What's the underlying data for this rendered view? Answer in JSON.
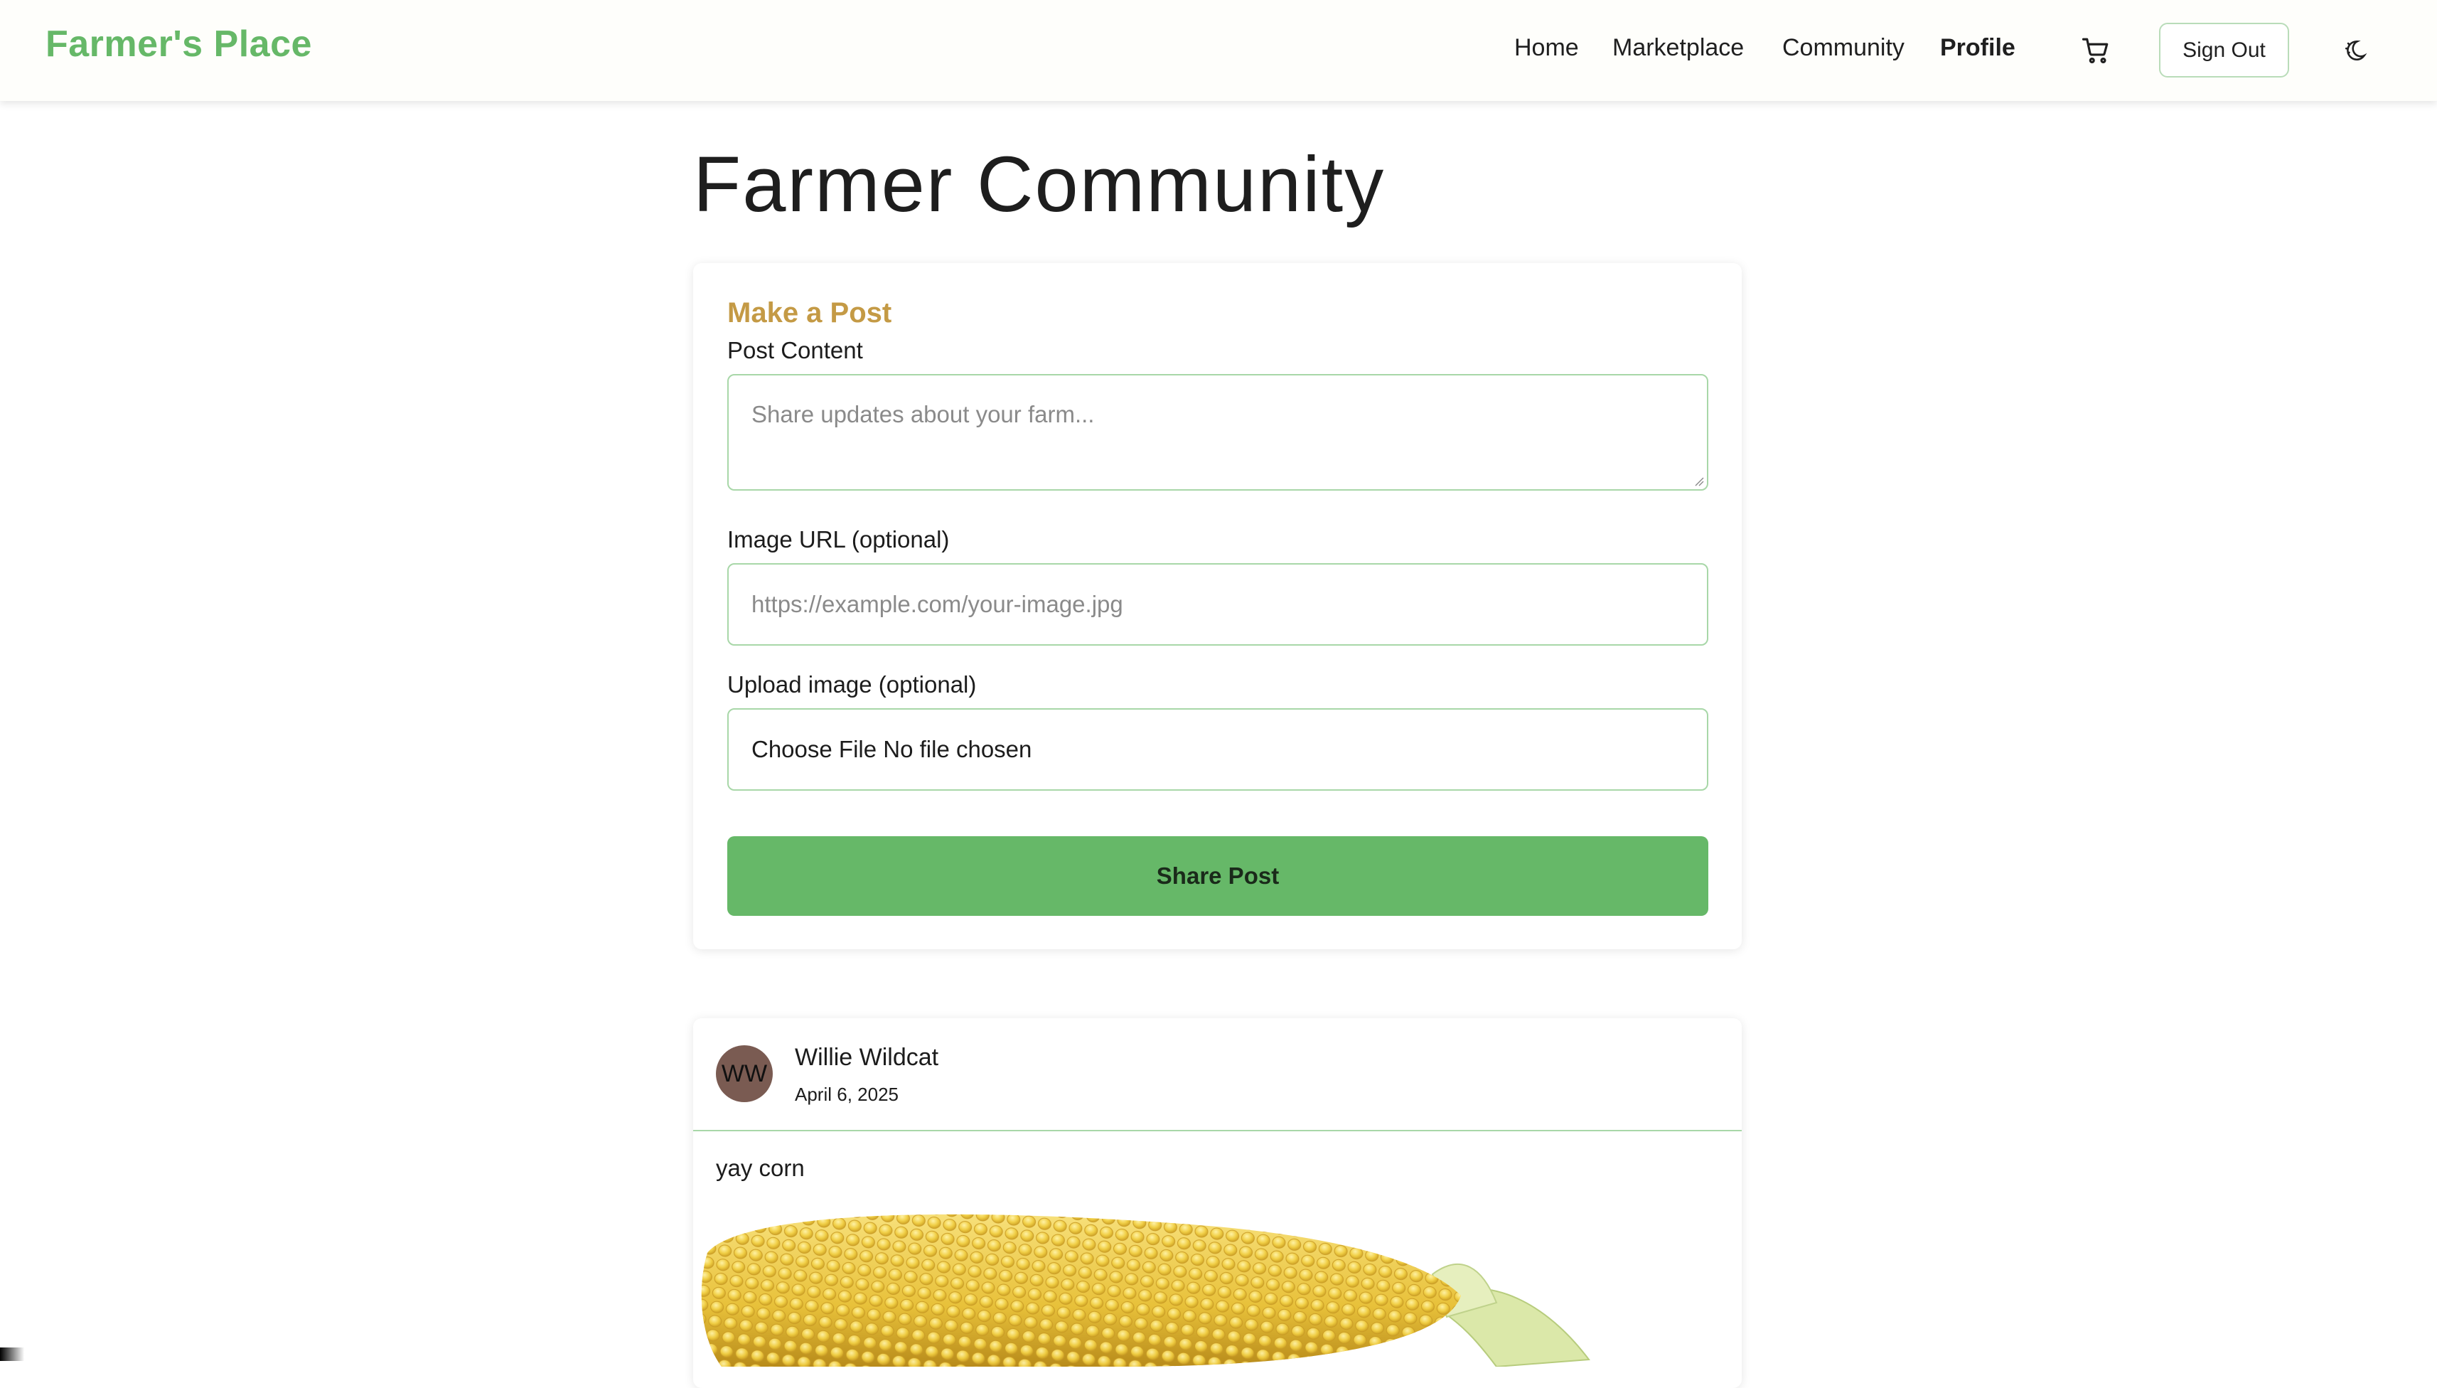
{
  "app": {
    "brand": "Farmer's Place"
  },
  "nav": {
    "links": [
      "Home",
      "Marketplace",
      "Community",
      "Profile"
    ],
    "active": "Profile",
    "signout_label": "Sign Out",
    "cart_icon": "shopping-cart-icon",
    "theme_icon": "theme-toggle-icon"
  },
  "page": {
    "title": "Farmer Community"
  },
  "post_form": {
    "heading": "Make a Post",
    "content_label": "Post Content",
    "content_placeholder": "Share updates about your farm...",
    "content_value": "",
    "image_url_label": "Image URL (optional)",
    "image_url_placeholder": "https://example.com/your-image.jpg",
    "image_url_value": "",
    "upload_label": "Upload image (optional)",
    "upload_text": "Choose File No file chosen",
    "submit_label": "Share Post"
  },
  "posts": [
    {
      "author_initials": "WW",
      "author": "Willie Wildcat",
      "date": "April 6, 2025",
      "text": "yay corn",
      "image": "corn-cob-image"
    }
  ],
  "colors": {
    "brand_green": "#66b868",
    "heading_gold": "#c49a45",
    "input_border": "#a8d7a8",
    "avatar_bg": "#7a5b52",
    "navbar_bg": "#fefefb"
  }
}
